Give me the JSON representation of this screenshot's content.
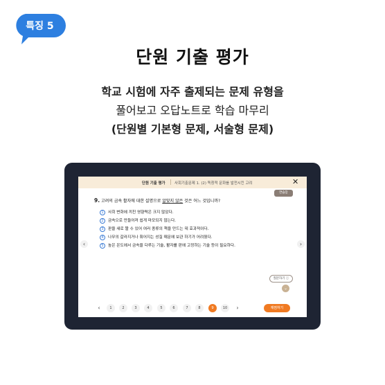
{
  "badge": {
    "label": "특징 5",
    "color": "#2d7fe0"
  },
  "heading": "단원 기출 평가",
  "description": {
    "line1": "학교 시험에 자주 출제되는 문제 유형을",
    "line2": "풀어보고 오답노트로 학습 마무리",
    "line3": "(단원별 기본형 문제, 서술형 문제)"
  },
  "screen": {
    "header": {
      "title": "단원 기출 평가",
      "subtitle": "사회기출문제 1. (2) 독창적 문화를 발전시킨 고려",
      "close_icon": "✕"
    },
    "chip": "연습장",
    "question": {
      "number": "9.",
      "text_before": "고려의 금속 활자에 대한 설명으로 ",
      "text_underlined": "알맞지 않은",
      "text_after": " 것은 어느 것입니까?"
    },
    "options": [
      {
        "num": "1",
        "text": "사회 변화에 끼친 영향력은 크지 않았다."
      },
      {
        "num": "2",
        "text": "금속으로 만들어져 쉽게 마모되지 않는다."
      },
      {
        "num": "3",
        "text": "판을 새로 짤 수 있어 여러 종류의 책을 만드는 데 효과적이다."
      },
      {
        "num": "4",
        "text": "나무의 갈라지거나 휘어지는 성질 때문에 보관 하기가 어려웠다."
      },
      {
        "num": "5",
        "text": "높은 온도에서 금속을 다루는 기술, 활자를 판에 고정하는 기술 등이 필요하다."
      }
    ],
    "prev_arrow": "‹",
    "next_arrow": "›",
    "memo_button": "질문하기 ⓘ",
    "down_icon": "⌄",
    "pagination": {
      "prev": "‹",
      "next": "›",
      "pages": [
        "1",
        "2",
        "3",
        "4",
        "5",
        "6",
        "7",
        "8",
        "9",
        "10"
      ],
      "active": "9"
    },
    "retry_button": "재점하기",
    "accent_color": "#f07a22"
  }
}
